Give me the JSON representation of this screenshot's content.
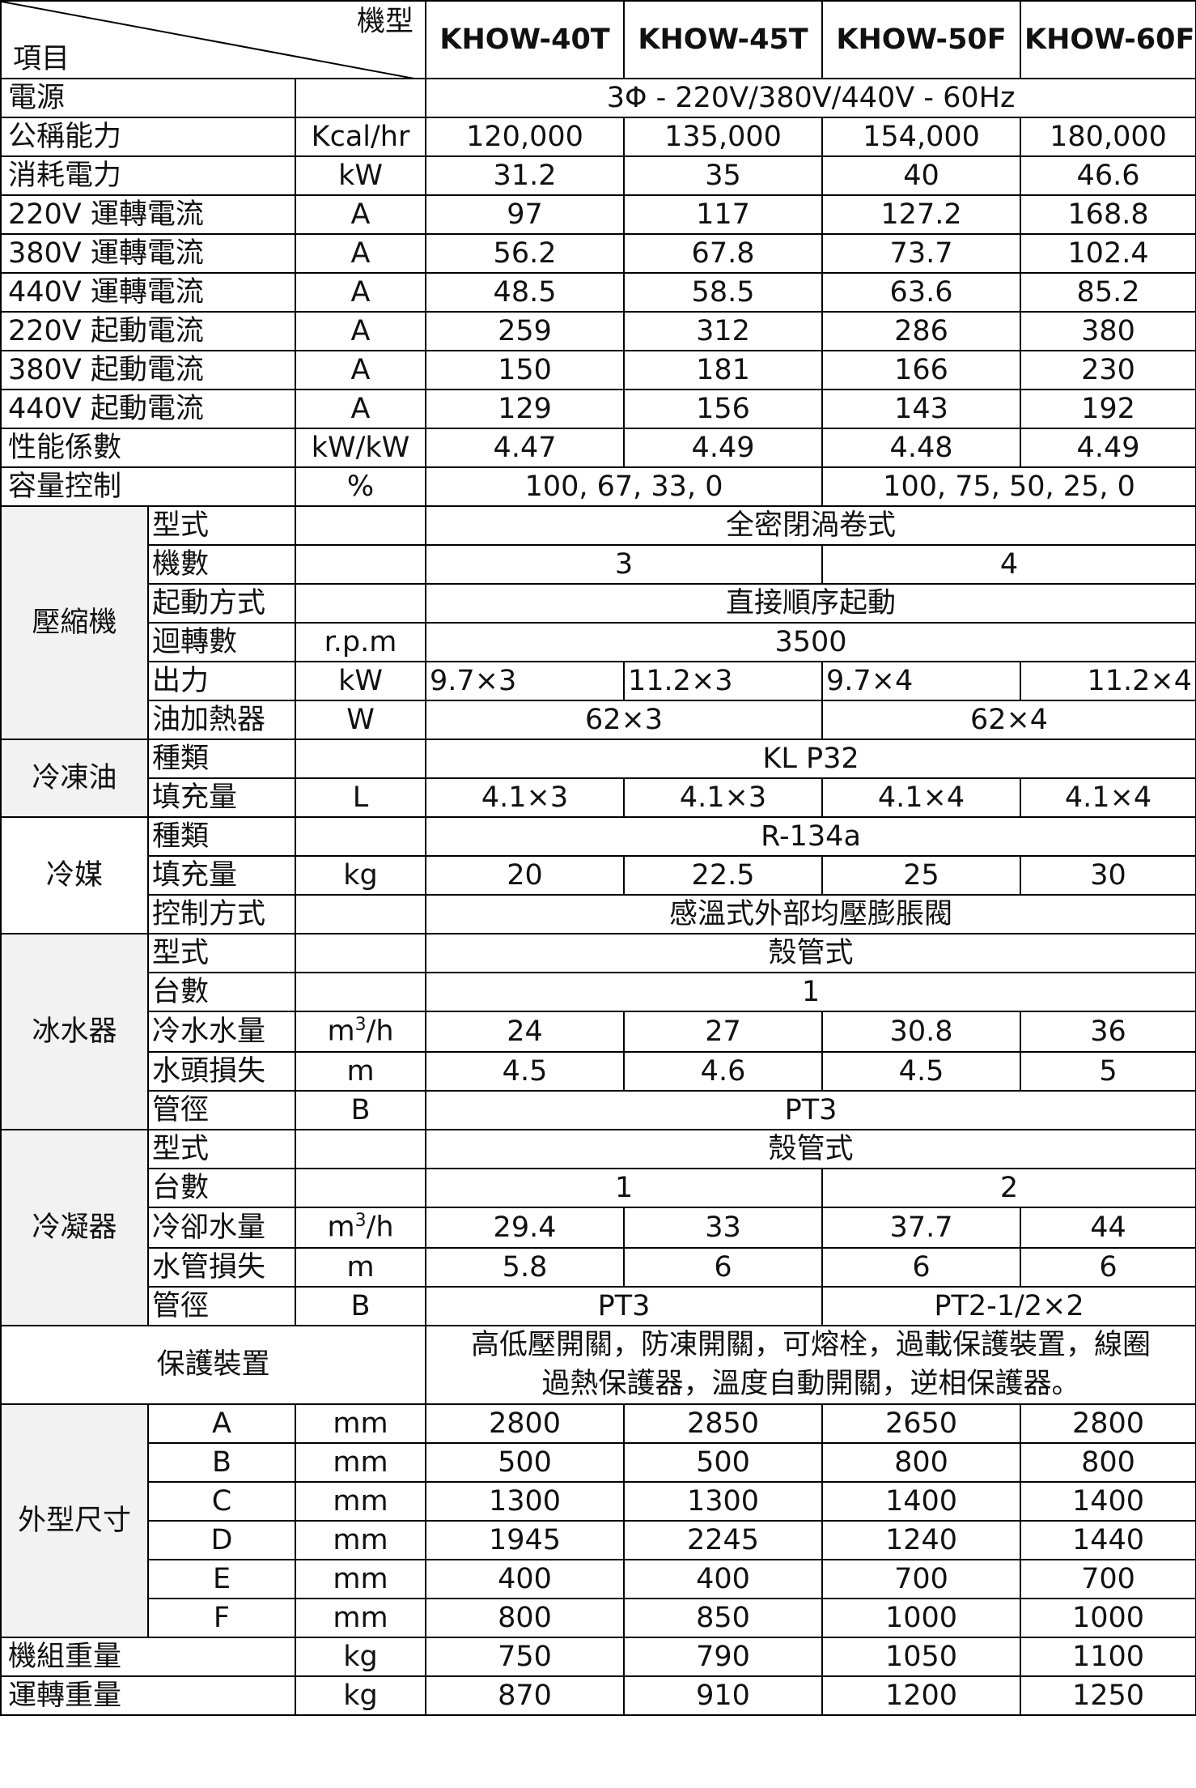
{
  "header": {
    "model_label": "機型",
    "item_label": "項目",
    "models": [
      "KHOW-40T",
      "KHOW-45T",
      "KHOW-50F",
      "KHOW-60F"
    ]
  },
  "general": [
    {
      "label": "電源",
      "unit": "",
      "merged": "3Φ - 220V/380V/440V - 60Hz"
    },
    {
      "label": "公稱能力",
      "unit": "Kcal/hr",
      "values": [
        "120,000",
        "135,000",
        "154,000",
        "180,000"
      ]
    },
    {
      "label": "消耗電力",
      "unit": "kW",
      "values": [
        "31.2",
        "35",
        "40",
        "46.6"
      ]
    },
    {
      "label": "220V 運轉電流",
      "unit": "A",
      "values": [
        "97",
        "117",
        "127.2",
        "168.8"
      ]
    },
    {
      "label": "380V 運轉電流",
      "unit": "A",
      "values": [
        "56.2",
        "67.8",
        "73.7",
        "102.4"
      ]
    },
    {
      "label": "440V 運轉電流",
      "unit": "A",
      "values": [
        "48.5",
        "58.5",
        "63.6",
        "85.2"
      ]
    },
    {
      "label": "220V 起動電流",
      "unit": "A",
      "values": [
        "259",
        "312",
        "286",
        "380"
      ]
    },
    {
      "label": "380V 起動電流",
      "unit": "A",
      "values": [
        "150",
        "181",
        "166",
        "230"
      ]
    },
    {
      "label": "440V 起動電流",
      "unit": "A",
      "values": [
        "129",
        "156",
        "143",
        "192"
      ]
    },
    {
      "label": "性能係數",
      "unit": "kW/kW",
      "values": [
        "4.47",
        "4.49",
        "4.48",
        "4.49"
      ]
    },
    {
      "label": "容量控制",
      "unit": "%",
      "pair": [
        "100, 67, 33, 0",
        "100, 75, 50, 25, 0"
      ]
    }
  ],
  "compressor": {
    "label": "壓縮機",
    "type": {
      "label": "型式",
      "value": "全密閉渦卷式"
    },
    "count": {
      "label": "機數",
      "pair": [
        "3",
        "4"
      ]
    },
    "start": {
      "label": "起動方式",
      "value": "直接順序起動"
    },
    "rpm": {
      "label": "迴轉數",
      "unit": "r.p.m",
      "value": "3500"
    },
    "output": {
      "label": "出力",
      "unit": "kW",
      "values": [
        "9.7×3",
        "11.2×3",
        "9.7×4",
        "11.2×4"
      ]
    },
    "heater": {
      "label": "油加熱器",
      "unit": "W",
      "pair": [
        "62×3",
        "62×4"
      ]
    }
  },
  "oil": {
    "label": "冷凍油",
    "type": {
      "label": "種類",
      "value": "KL P32"
    },
    "charge": {
      "label": "填充量",
      "unit": "L",
      "values": [
        "4.1×3",
        "4.1×3",
        "4.1×4",
        "4.1×4"
      ]
    }
  },
  "refrigerant": {
    "label": "冷媒",
    "type": {
      "label": "種類",
      "value": "R-134a"
    },
    "charge": {
      "label": "填充量",
      "unit": "kg",
      "values": [
        "20",
        "22.5",
        "25",
        "30"
      ]
    },
    "control": {
      "label": "控制方式",
      "value": "感溫式外部均壓膨脹閥"
    }
  },
  "chiller": {
    "label": "冰水器",
    "type": {
      "label": "型式",
      "value": "殼管式"
    },
    "count": {
      "label": "台數",
      "value": "1"
    },
    "flow": {
      "label": "冷水水量",
      "unit_base": "m",
      "unit_sup": "3",
      "unit_tail": "/h",
      "values": [
        "24",
        "27",
        "30.8",
        "36"
      ]
    },
    "loss": {
      "label": "水頭損失",
      "unit": "m",
      "values": [
        "4.5",
        "4.6",
        "4.5",
        "5"
      ]
    },
    "pipe": {
      "label": "管徑",
      "unit": "B",
      "value": "PT3"
    }
  },
  "condenser": {
    "label": "冷凝器",
    "type": {
      "label": "型式",
      "value": "殼管式"
    },
    "count": {
      "label": "台數",
      "pair": [
        "1",
        "2"
      ]
    },
    "flow": {
      "label": "冷卻水量",
      "unit_base": "m",
      "unit_sup": "3",
      "unit_tail": "/h",
      "values": [
        "29.4",
        "33",
        "37.7",
        "44"
      ]
    },
    "loss": {
      "label": "水管損失",
      "unit": "m",
      "values": [
        "5.8",
        "6",
        "6",
        "6"
      ]
    },
    "pipe": {
      "label": "管徑",
      "unit": "B",
      "pair": [
        "PT3",
        "PT2-1/2×2"
      ]
    }
  },
  "protection": {
    "label": "保護裝置",
    "line1": "高低壓開關，防凍開關，可熔栓，過載保護裝置，線圈",
    "line2": "過熱保護器，溫度自動開關，逆相保護器。"
  },
  "dimensions": {
    "label": "外型尺寸",
    "rows": [
      {
        "letter": "A",
        "unit": "mm",
        "values": [
          "2800",
          "2850",
          "2650",
          "2800"
        ]
      },
      {
        "letter": "B",
        "unit": "mm",
        "values": [
          "500",
          "500",
          "800",
          "800"
        ]
      },
      {
        "letter": "C",
        "unit": "mm",
        "values": [
          "1300",
          "1300",
          "1400",
          "1400"
        ]
      },
      {
        "letter": "D",
        "unit": "mm",
        "values": [
          "1945",
          "2245",
          "1240",
          "1440"
        ]
      },
      {
        "letter": "E",
        "unit": "mm",
        "values": [
          "400",
          "400",
          "700",
          "700"
        ]
      },
      {
        "letter": "F",
        "unit": "mm",
        "values": [
          "800",
          "850",
          "1000",
          "1000"
        ]
      }
    ]
  },
  "weights": [
    {
      "label": "機組重量",
      "unit": "kg",
      "values": [
        "750",
        "790",
        "1050",
        "1100"
      ]
    },
    {
      "label": "運轉重量",
      "unit": "kg",
      "values": [
        "870",
        "910",
        "1200",
        "1250"
      ]
    }
  ]
}
